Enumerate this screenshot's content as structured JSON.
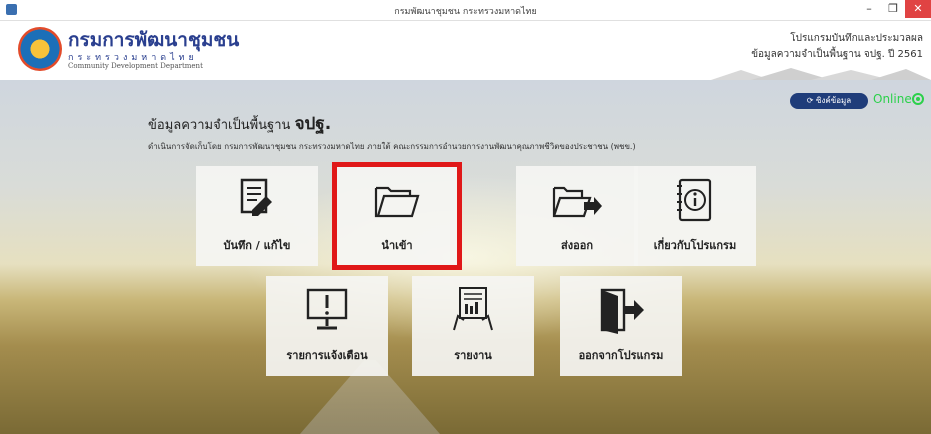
{
  "window": {
    "title": "กรมพัฒนาชุมชน กระทรวงมหาดไทย",
    "min_label": "–",
    "max_label": "❐",
    "close_label": "✕"
  },
  "header": {
    "brand_th": "กรมการพัฒนาชุมชน",
    "brand_th_small": "กระทรวงมหาดไทย",
    "brand_en": "Community Development Department",
    "program_line1": "โปรแกรมบันทึกและประมวลผล",
    "program_line2": "ข้อมูลความจำเป็นพื้นฐาน จปฐ. ปี 2561"
  },
  "main": {
    "title_prefix": "ข้อมูลความจำเป็นพื้นฐาน",
    "title_bold": "จปฐ.",
    "subtitle": "ดำเนินการจัดเก็บโดย กรมการพัฒนาชุมชน กระทรวงมหาดไทย ภายใต้ คณะกรรมการอำนวยการงานพัฒนาคุณภาพชีวิตของประชาชน (พชข.)",
    "sync_label": "ซิงค์ข้อมูล",
    "sync_icon": "refresh-icon",
    "online_label": "Online"
  },
  "tiles": [
    {
      "label": "บันทึก / แก้ไข",
      "icon": "edit-document-icon"
    },
    {
      "label": "นำเข้า",
      "icon": "folder-open-icon",
      "selected": true
    },
    {
      "label": "ส่งออก",
      "icon": "folder-export-icon"
    },
    {
      "label": "เกี่ยวกับโปรแกรม",
      "icon": "info-notebook-icon"
    },
    {
      "label": "รายการแจ้งเตือน",
      "icon": "monitor-alert-icon"
    },
    {
      "label": "รายงาน",
      "icon": "report-icon"
    },
    {
      "label": "ออกจากโปรแกรม",
      "icon": "exit-door-icon"
    }
  ],
  "colors": {
    "brand": "#2a3f8f",
    "selection": "#e01818",
    "online": "#2bd14a",
    "sync_button": "#1f3d7a"
  }
}
